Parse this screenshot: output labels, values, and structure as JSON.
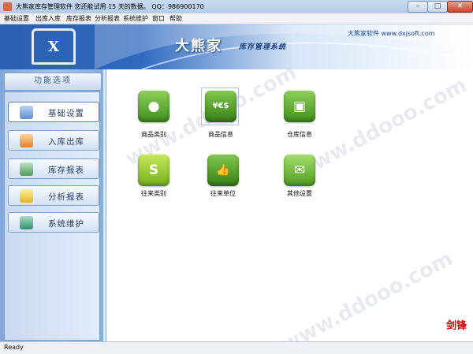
{
  "window": {
    "title": "大熊家库存管理软件  您还能试用 15 天的数据。  QQ：986900170",
    "buttons": {
      "minimize": "–",
      "maximize": "□",
      "close": "✕"
    }
  },
  "menu": [
    "基础设置",
    "出库入库",
    "库存报表",
    "分析报表",
    "系统维护",
    "窗口",
    "帮助"
  ],
  "banner": {
    "logo_letter": "X",
    "brand": "大熊家",
    "subtitle": "库存管理系统",
    "website": "大熊家软件 www.dxjsoft.com"
  },
  "sidebar": {
    "header": "功能选项",
    "items": [
      {
        "label": "基础设置",
        "icon": "box-icon",
        "active": true
      },
      {
        "label": "入库出库",
        "icon": "inbound-icon",
        "active": false
      },
      {
        "label": "库存报表",
        "icon": "stack-icon",
        "active": false
      },
      {
        "label": "分析报表",
        "icon": "chart-icon",
        "active": false
      },
      {
        "label": "系统维护",
        "icon": "network-icon",
        "active": false
      }
    ]
  },
  "tiles": [
    {
      "label": "商品类别",
      "icon": "chat-bubble-icon",
      "glyph": "●",
      "color": "#5aa52c"
    },
    {
      "label": "商品信息",
      "icon": "currency-icon",
      "glyph": "¥€$",
      "color": "#4e9a24"
    },
    {
      "label": "仓库信息",
      "icon": "rss-tablet-icon",
      "glyph": "▣",
      "color": "#5aa52c"
    },
    {
      "label": "往来类别",
      "icon": "barcode-icon",
      "glyph": "S",
      "color": "#8cc22e"
    },
    {
      "label": "往来单位",
      "icon": "thumbs-up-icon",
      "glyph": "👍",
      "color": "#4e9a24"
    },
    {
      "label": "其他设置",
      "icon": "basket-icon",
      "glyph": "✉",
      "color": "#6db33a"
    }
  ],
  "watermark": {
    "corner_text": "剑锋"
  },
  "status": {
    "text": "Ready"
  }
}
